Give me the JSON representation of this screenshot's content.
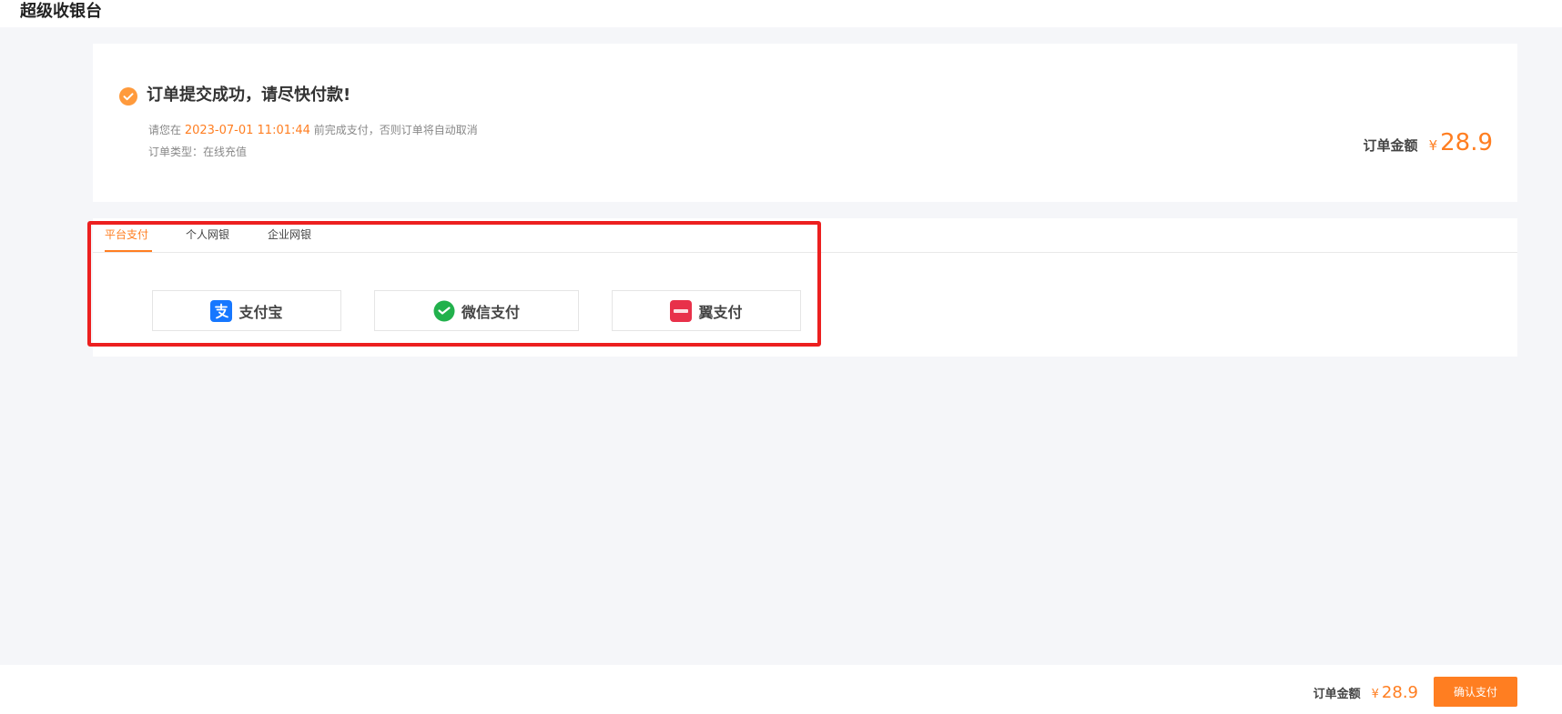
{
  "app": {
    "title": "超级收银台"
  },
  "order": {
    "success_title": "订单提交成功，请尽快付款!",
    "deadline_prefix": "请您在",
    "deadline_date": "2023-07-01 11:01:44",
    "deadline_suffix": "前完成支付，否则订单将自动取消",
    "order_type_label": "订单类型：",
    "order_type_value": "在线充值",
    "amount_label": "订单金额",
    "currency": "¥",
    "amount_value": "28.9"
  },
  "payment": {
    "tabs": [
      {
        "label": "平台支付",
        "active": true
      },
      {
        "label": "个人网银",
        "active": false
      },
      {
        "label": "企业网银",
        "active": false
      }
    ],
    "options": [
      {
        "label": "支付宝",
        "icon": "alipay-icon",
        "color": "#1677ff"
      },
      {
        "label": "微信支付",
        "icon": "wechat-pay-icon",
        "color": "#22b14c"
      },
      {
        "label": "翼支付",
        "icon": "bestpay-icon",
        "color": "#e8314a"
      }
    ]
  },
  "footer": {
    "amount_label": "订单金额",
    "currency": "¥",
    "amount_value": "28.9",
    "confirm_label": "确认支付"
  },
  "colors": {
    "accent": "#ff7e21",
    "highlight_border": "#ec1f1f",
    "page_background": "#f5f6f9"
  }
}
